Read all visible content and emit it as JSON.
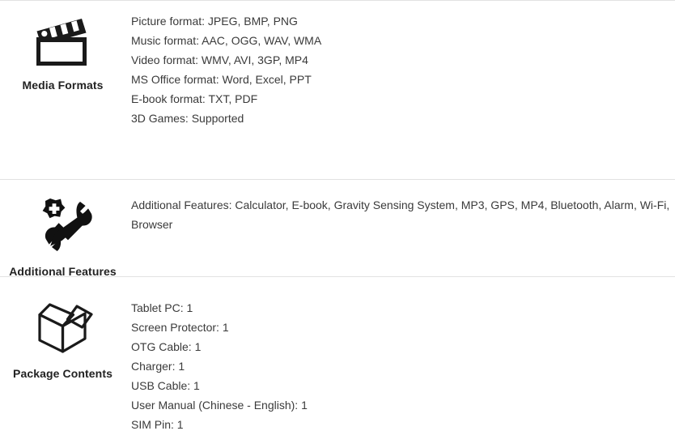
{
  "page": {
    "divider_color": "#e2e2e2",
    "text_color": "#3a3a3a",
    "heading_color": "#222222"
  },
  "sections": [
    {
      "id": "media-formats",
      "icon": "clapperboard-icon",
      "caption": "Media Formats",
      "lines": [
        "Picture format: JPEG, BMP, PNG",
        "Music format: AAC, OGG, WAV, WMA",
        "Video format: WMV, AVI, 3GP, MP4",
        "MS Office format: Word, Excel, PPT",
        "E-book format: TXT, PDF",
        "3D Games: Supported"
      ]
    },
    {
      "id": "additional-features",
      "icon": "wrench-screwdriver-icon",
      "caption": "Additional Features",
      "paragraph": "Additional Features: Calculator, E-book, Gravity Sensing System, MP3, GPS, MP4, Bluetooth, Alarm, Wi-Fi, Browser"
    },
    {
      "id": "package-contents",
      "icon": "open-box-icon",
      "caption": "Package Contents",
      "lines": [
        "Tablet PC: 1",
        "Screen Protector: 1",
        "OTG Cable: 1",
        "Charger: 1",
        "USB Cable: 1",
        "User Manual (Chinese - English): 1",
        "SIM Pin: 1"
      ]
    }
  ]
}
